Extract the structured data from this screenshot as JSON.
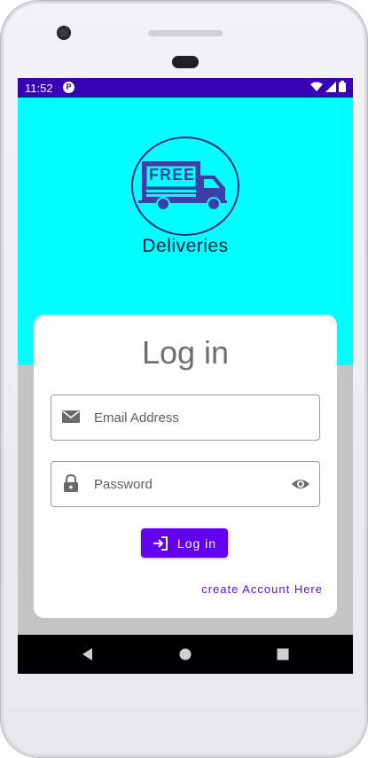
{
  "status_bar": {
    "time": "11:52",
    "badge_icon": "notification-badge-icon",
    "icons": [
      "wifi-icon",
      "signal-icon",
      "battery-icon"
    ]
  },
  "logo": {
    "badge_text": "FREE",
    "caption": "Deliveries",
    "icon": "delivery-truck-icon"
  },
  "login": {
    "title": "Log in",
    "email_placeholder": "Email Address",
    "email_icon": "mail-icon",
    "password_placeholder": "Password",
    "password_icon": "lock-icon",
    "visibility_icon": "eye-icon",
    "button_label": "Log in",
    "button_icon": "login-arrow-icon",
    "create_account_label": "create Account Here"
  },
  "nav_bar": {
    "items": [
      "back-icon",
      "home-icon",
      "recents-icon"
    ]
  },
  "colors": {
    "hero_bg": "#00ffff",
    "status_bar": "#3700b3",
    "primary": "#6200ee",
    "lower_bg": "#c4c4c4",
    "link": "#4a12d6"
  }
}
